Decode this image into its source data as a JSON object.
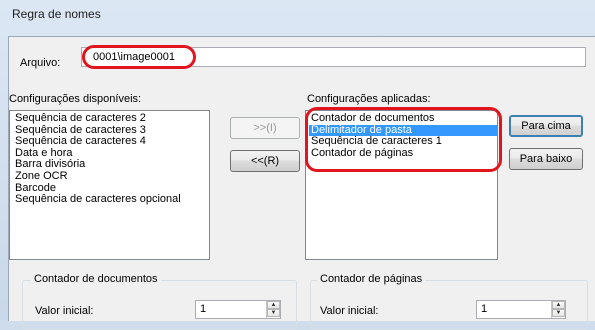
{
  "window": {
    "title": "Regra de nomes"
  },
  "file": {
    "label": "Arquivo:",
    "value": "0001\\image0001"
  },
  "available": {
    "label": "Configurações disponíveis:",
    "items": [
      "Sequência de caracteres 2",
      "Sequência de caracteres 3",
      "Sequência de caracteres 4",
      "Data e hora",
      "Barra divisória",
      "Zone OCR",
      "Barcode",
      "Sequência de caracteres opcional"
    ]
  },
  "buttons": {
    "add": ">>(I)",
    "remove": "<<(R)",
    "up": "Para cima",
    "down": "Para baixo"
  },
  "applied": {
    "label": "Configurações aplicadas:",
    "items": [
      "Contador de documentos",
      "Delimitador de pasta",
      "Sequência de caracteres 1",
      "Contador de páginas"
    ],
    "selected_index": 1
  },
  "doc_counter": {
    "title": "Contador de documentos",
    "label": "Valor inicial:",
    "value": "1"
  },
  "page_counter": {
    "title": "Contador de páginas",
    "label": "Valor inicial:",
    "value": "1"
  },
  "colors": {
    "highlight_ring": "#e0151d",
    "selection": "#3399ff"
  }
}
